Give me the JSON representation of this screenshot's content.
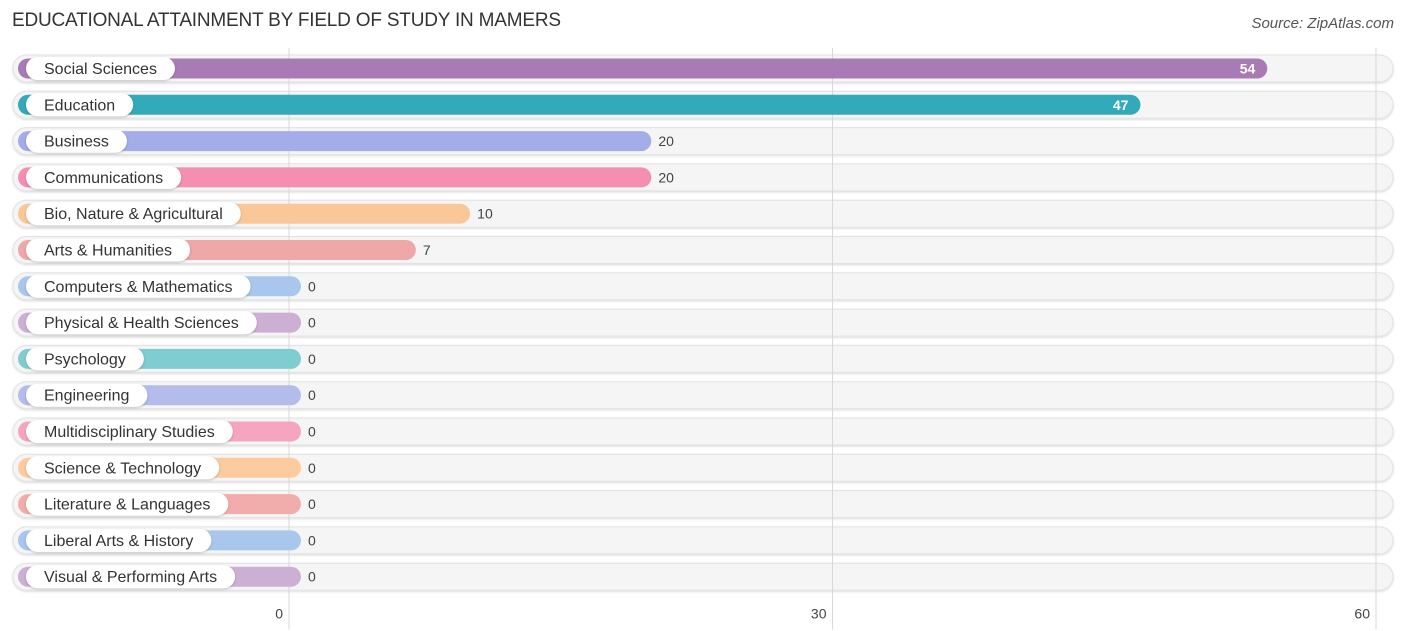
{
  "header": {
    "title": "EDUCATIONAL ATTAINMENT BY FIELD OF STUDY IN MAMERS",
    "source": "Source: ZipAtlas.com"
  },
  "chart_data": {
    "type": "bar",
    "orientation": "horizontal",
    "title": "EDUCATIONAL ATTAINMENT BY FIELD OF STUDY IN MAMERS",
    "xlabel": "",
    "ylabel": "",
    "xlim": [
      0,
      60
    ],
    "x_ticks": [
      0,
      30,
      60
    ],
    "x_tick_labels": [
      "0",
      "30",
      "60"
    ],
    "grid": true,
    "categories": [
      "Social Sciences",
      "Education",
      "Business",
      "Communications",
      "Bio, Nature & Agricultural",
      "Arts & Humanities",
      "Computers & Mathematics",
      "Physical & Health Sciences",
      "Psychology",
      "Engineering",
      "Multidisciplinary Studies",
      "Science & Technology",
      "Literature & Languages",
      "Liberal Arts & History",
      "Visual & Performing Arts"
    ],
    "values": [
      54,
      47,
      20,
      20,
      10,
      7,
      0,
      0,
      0,
      0,
      0,
      0,
      0,
      0,
      0
    ],
    "value_labels": [
      "54",
      "47",
      "20",
      "20",
      "10",
      "7",
      "0",
      "0",
      "0",
      "0",
      "0",
      "0",
      "0",
      "0",
      "0"
    ],
    "colors": [
      "#a97bb5",
      "#33aab9",
      "#a3aee8",
      "#f48fb1",
      "#fac898",
      "#eea8a8",
      "#a9c7ec",
      "#cbb0d4",
      "#7fcdd1",
      "#b4bcec",
      "#f6a5c0",
      "#fccb9e",
      "#f0adab",
      "#a9c7ec",
      "#cbb0d4"
    ],
    "value_label_inside": [
      true,
      true,
      false,
      false,
      false,
      false,
      false,
      false,
      false,
      false,
      false,
      false,
      false,
      false,
      false
    ]
  }
}
